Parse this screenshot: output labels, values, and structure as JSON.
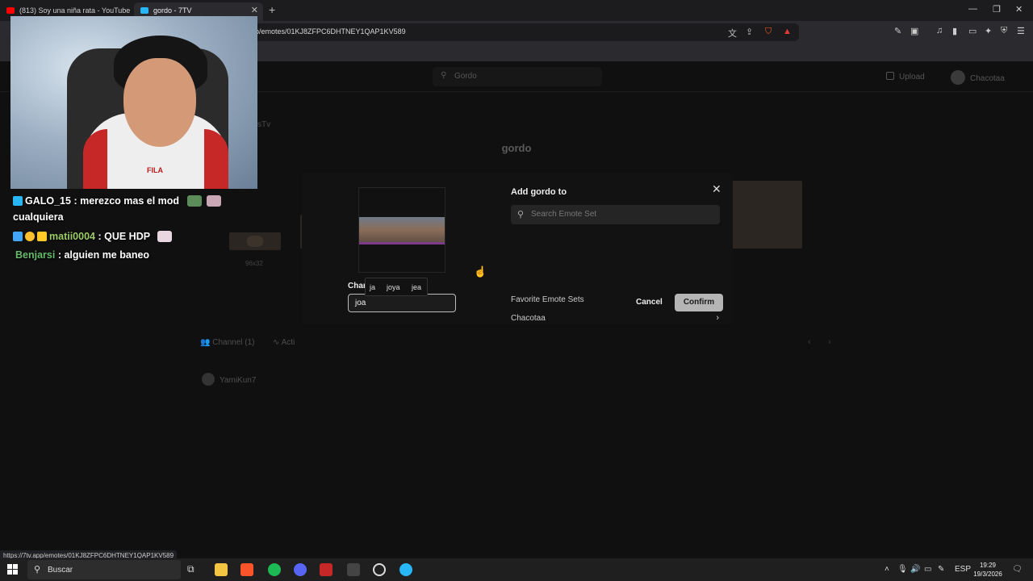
{
  "browser": {
    "tabs": [
      {
        "title": "(813) Soy una niña rata - YouTube",
        "icon": "youtube-icon",
        "color": "#ff0000"
      },
      {
        "title": "gordo - 7TV",
        "icon": "7tv-icon",
        "color": "#29b6f6"
      }
    ],
    "new_tab": "+",
    "url_visible": "p/emotes/01KJ8ZFPC6DHTNEY1QAP1KV589",
    "status_url": "https://7tv.app/emotes/01KJ8ZFPC6DHTNEY1QAP1KV589"
  },
  "site": {
    "search_placeholder": "Gordo",
    "upload_label": "Upload",
    "username": "Chacotaa",
    "author_fragment": "sTv",
    "emote_name": "gordo",
    "size_label": "96x32",
    "channel_tab": "Channel (1)",
    "activity_tab": "Acti",
    "channel_user": "YamiKun7"
  },
  "modal": {
    "title": "Add gordo to",
    "search_placeholder": "Search Emote Set",
    "sets": [
      "Favorite Emote Sets",
      "Chacotaa"
    ],
    "name_label": "Char",
    "name_value": "joa",
    "suggestions": [
      "ja",
      "joya",
      "jea"
    ],
    "cancel_label": "Cancel",
    "confirm_label": "Confirm"
  },
  "stream": {
    "shirt_brand": "FILA",
    "chat": [
      {
        "user": "GALO_15",
        "message": ": merezco mas el mod",
        "continuation": "cualquiera",
        "color": "#ffffff",
        "badge_color": "#29b6f6"
      },
      {
        "user": "matii0004",
        "message": ": QUE HDP",
        "color": "#9ccc65",
        "badge_color": "#42a5f5"
      },
      {
        "user": "Benjarsi",
        "message": ": alguien me baneo",
        "color": "#66bb6a"
      }
    ]
  },
  "taskbar": {
    "search_label": "Buscar",
    "language": "ESP",
    "time": "19:29",
    "date": "19/3/2026"
  }
}
